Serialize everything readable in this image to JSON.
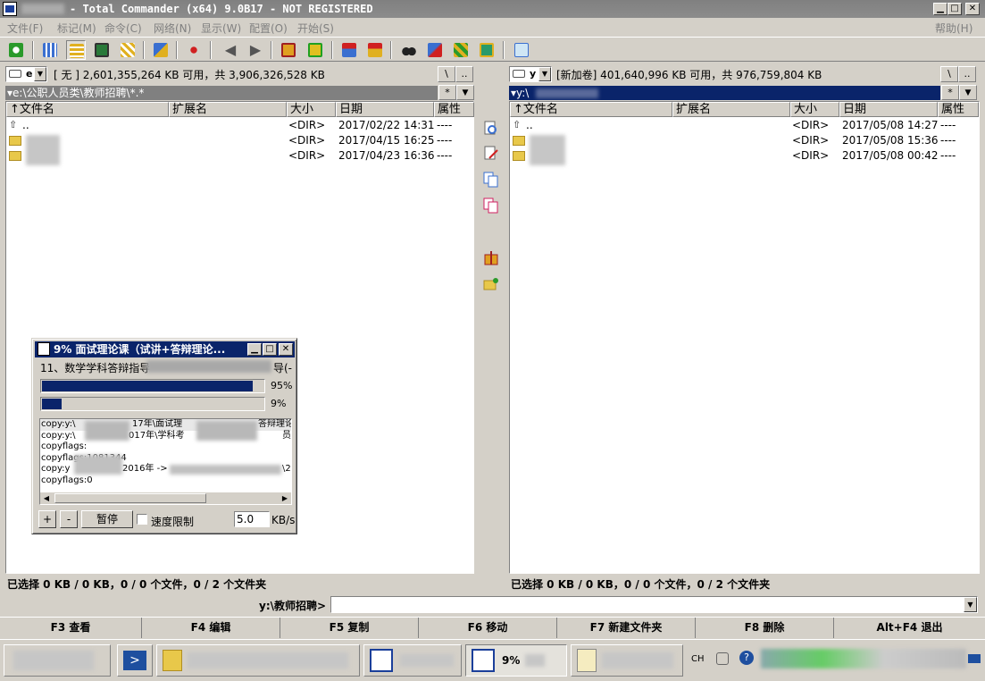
{
  "window": {
    "title": "- Total Commander (x64) 9.0B17 - NOT REGISTERED"
  },
  "menu": {
    "items": [
      "文件(F)",
      "标记(M)",
      "命令(C)",
      "网络(N)",
      "显示(W)",
      "配置(O)",
      "开始(S)"
    ],
    "help": "帮助(H)"
  },
  "toolbar": {
    "icons": [
      "refresh-icon",
      "brief-view-icon",
      "full-view-icon",
      "thumbnail-view-icon",
      "tree-view-icon",
      "compare-dirs-icon",
      "select-files-icon",
      "back-icon",
      "forward-icon",
      "pack-icon",
      "unpack-icon",
      "ftp-connect-icon",
      "url-connect-icon",
      "search-icon",
      "sync-dirs-icon",
      "multi-rename-icon",
      "multimedia-icon",
      "notepad-icon"
    ]
  },
  "left": {
    "drive": "e",
    "disk_info": "[ 无 ]  2,601,355,264 KB 可用，共 3,906,326,528 KB",
    "root_btn": "\\",
    "up_btn": "..",
    "path": "▾e:\\公职人员类\\教师招聘\\*.*",
    "star_btn": "*",
    "headers": {
      "name": "↑文件名",
      "ext": "扩展名",
      "size": "大小",
      "date": "日期",
      "attr": "属性"
    },
    "rows": [
      {
        "name": "..",
        "size": "<DIR>",
        "date": "2017/02/22 14:31",
        "attr": "----"
      },
      {
        "name": "",
        "size": "<DIR>",
        "date": "2017/04/15 16:25",
        "attr": "----"
      },
      {
        "name": "",
        "size": "<DIR>",
        "date": "2017/04/23 16:36",
        "attr": "----"
      }
    ],
    "status": "已选择 0 KB / 0 KB，0 / 0 个文件，0 / 2 个文件夹"
  },
  "right": {
    "drive": "y",
    "disk_info": "[新加卷]  401,640,996 KB 可用，共 976,759,804 KB",
    "root_btn": "\\",
    "up_btn": "..",
    "path": "▾y:\\",
    "star_btn": "*",
    "headers": {
      "name": "↑文件名",
      "ext": "扩展名",
      "size": "大小",
      "date": "日期",
      "attr": "属性"
    },
    "rows": [
      {
        "name": "..",
        "size": "<DIR>",
        "date": "2017/05/08 14:27",
        "attr": "----"
      },
      {
        "name": "",
        "size": "<DIR>",
        "date": "2017/05/08 15:36",
        "attr": "----"
      },
      {
        "name": "",
        "size": "<DIR>",
        "date": "2017/05/08 00:42",
        "attr": "----"
      }
    ],
    "status": "已选择 0 KB / 0 KB，0 / 0 个文件，0 / 2 个文件夹"
  },
  "middle_icons": [
    "view-file-icon",
    "edit-file-icon",
    "copy-file-icon",
    "move-file-icon",
    "pack-files-icon",
    "new-folder-icon"
  ],
  "command": {
    "label": "y:\\教师招聘>",
    "value": ""
  },
  "fkeys": [
    "F3 查看",
    "F4 编辑",
    "F5 复制",
    "F6 移动",
    "F7 新建文件夹",
    "F8 删除",
    "Alt+F4 退出"
  ],
  "copy_dialog": {
    "title": "9% 面试理论课（试讲+答辩理论...",
    "current_file": "11、数学学科答辩指导",
    "current_file_tail": "导(-",
    "file_progress": 0.95,
    "file_progress_label": "95%",
    "total_progress": 0.09,
    "total_progress_label": "9%",
    "log": [
      "copy:y:\\",
      "copy:y:\\",
      "copyflags:",
      "copyflags:1081344",
      "copy:y",
      "copyflags:0"
    ],
    "log_fragments": [
      "17年\\面试理",
      "答辩理论",
      "017年\\学科考",
      "员",
      "2016年 ->",
      "\\2"
    ],
    "plus_btn": "+",
    "minus_btn": "-",
    "pause_btn": "暂停",
    "speed_limit_label": "速度限制",
    "speed_value": "5.0",
    "speed_unit": "KB/s"
  },
  "taskbar": {
    "active_task_label": "9%",
    "tray_text": "CH"
  },
  "colors": {
    "face": "#d4d0c8",
    "active_caption": "#0a246a",
    "inactive_caption": "#808080"
  }
}
